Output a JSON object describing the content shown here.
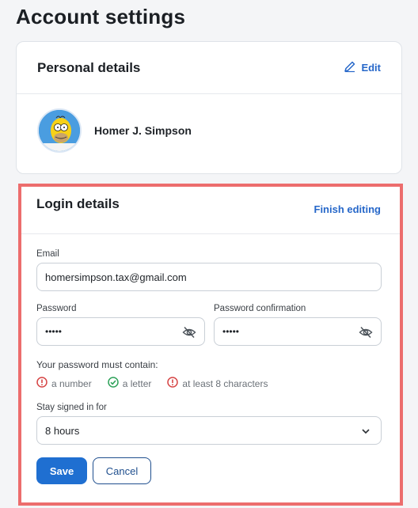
{
  "page": {
    "title": "Account settings"
  },
  "personal": {
    "title": "Personal details",
    "edit_label": "Edit",
    "user_name": "Homer J. Simpson"
  },
  "login": {
    "title": "Login details",
    "finish_label": "Finish editing",
    "email_label": "Email",
    "email_value": "homersimpson.tax@gmail.com",
    "password_label": "Password",
    "password_value": "•••••",
    "confirm_label": "Password confirmation",
    "confirm_value": "•••••",
    "requirements_title": "Your password must contain:",
    "requirements": [
      {
        "label": "a number",
        "status": "error"
      },
      {
        "label": "a letter",
        "status": "ok"
      },
      {
        "label": "at least 8 characters",
        "status": "error"
      }
    ],
    "stay_label": "Stay signed in for",
    "stay_value": "8 hours",
    "save_label": "Save",
    "cancel_label": "Cancel"
  },
  "colors": {
    "accent": "#1f6fd1",
    "error": "#d64545",
    "ok": "#2fa25a",
    "highlight": "#ec6d6d"
  },
  "icons": {
    "edit": "pencil-icon",
    "eye": "eye-off-icon",
    "chevron": "chevron-down-icon"
  }
}
